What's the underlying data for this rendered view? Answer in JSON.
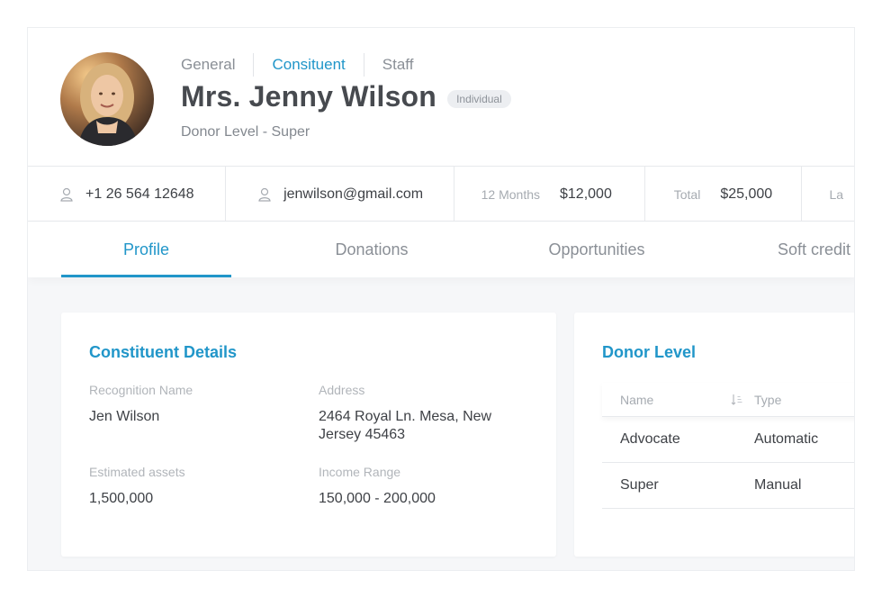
{
  "profile": {
    "role_tabs": [
      {
        "label": "General"
      },
      {
        "label": "Consituent"
      },
      {
        "label": "Staff"
      }
    ],
    "name": "Mrs. Jenny Wilson",
    "badge": "Individual",
    "donor_level": "Donor Level - Super"
  },
  "stats": {
    "phone": "+1 26 564 12648",
    "email": "jenwilson@gmail.com",
    "months_label": "12 Months",
    "months_value": "$12,000",
    "total_label": "Total",
    "total_value": "$25,000",
    "truncated_label": "La"
  },
  "tabs": [
    {
      "label": "Profile"
    },
    {
      "label": "Donations"
    },
    {
      "label": "Opportunities"
    },
    {
      "label": "Soft credit"
    }
  ],
  "constituent_details": {
    "title": "Constituent Details",
    "recognition_name_label": "Recognition Name",
    "recognition_name": "Jen Wilson",
    "address_label": "Address",
    "address": "2464 Royal Ln. Mesa, New Jersey 45463",
    "estimated_assets_label": "Estimated assets",
    "estimated_assets": "1,500,000",
    "income_range_label": "Income Range",
    "income_range": "150,000 - 200,000"
  },
  "donor_level_card": {
    "title": "Donor Level",
    "columns": {
      "name": "Name",
      "type": "Type"
    },
    "rows": [
      {
        "name": "Advocate",
        "type": "Automatic"
      },
      {
        "name": "Super",
        "type": "Manual"
      }
    ]
  },
  "icons": {
    "phone": "user-icon",
    "email": "user-icon",
    "sort": "sort-icon"
  },
  "colors": {
    "accent": "#2196c9",
    "text": "#3e4146",
    "muted": "#8a8f96"
  }
}
